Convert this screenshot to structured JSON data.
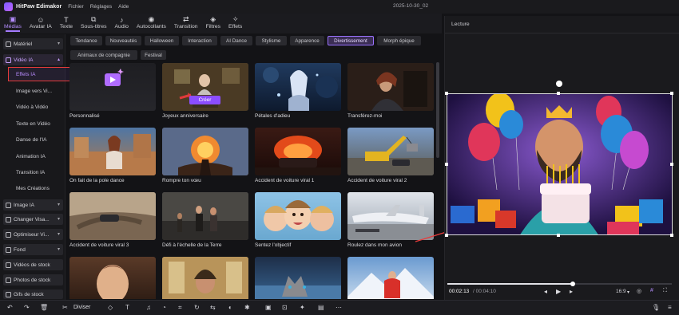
{
  "app": {
    "name": "HitPaw Edimakor",
    "menus": [
      "Fichier",
      "Réglages",
      "Aide"
    ],
    "doc_title": "2025-10-30_02"
  },
  "toolbar": [
    {
      "label": "Médias",
      "icon": "media-icon",
      "glyph": "▣",
      "active": true
    },
    {
      "label": "Avatar IA",
      "icon": "avatar-icon",
      "glyph": "☺",
      "active": false
    },
    {
      "label": "Texte",
      "icon": "text-icon",
      "glyph": "T",
      "active": false
    },
    {
      "label": "Sous-titres",
      "icon": "subtitles-icon",
      "glyph": "⧉",
      "active": false
    },
    {
      "label": "Audio",
      "icon": "audio-icon",
      "glyph": "♪",
      "active": false
    },
    {
      "label": "Autocollants",
      "icon": "sticker-icon",
      "glyph": "◉",
      "active": false
    },
    {
      "label": "Transition",
      "icon": "transition-icon",
      "glyph": "⇄",
      "active": false
    },
    {
      "label": "Filtres",
      "icon": "filter-icon",
      "glyph": "◈",
      "active": false
    },
    {
      "label": "Effets",
      "icon": "effects-icon",
      "glyph": "✧",
      "active": false
    }
  ],
  "sidebar": {
    "categories": [
      {
        "label": "Matériel",
        "open": false
      },
      {
        "label": "Vidéo IA",
        "open": true
      },
      {
        "label": "Image IA",
        "open": false
      },
      {
        "label": "Changer Visa...",
        "open": false
      },
      {
        "label": "Optimiseur Vi...",
        "open": false
      },
      {
        "label": "Fond",
        "open": false
      },
      {
        "label": "Vidéos de stock",
        "open": false
      },
      {
        "label": "Photos de stock",
        "open": false
      },
      {
        "label": "Gifs de stock",
        "open": false
      }
    ],
    "sub_items": [
      "Effets IA",
      "Image vers Vi...",
      "Vidéo à Vidéo",
      "Texte en Vidéo",
      "Danse de l'IA",
      "Animation IA",
      "Transition IA",
      "Mes Créations"
    ]
  },
  "chips": [
    "Tendance",
    "Nouveautés",
    "Halloween",
    "Interaction",
    "AI Dance",
    "Stylisme",
    "Apparence",
    "Divertissement",
    "Morph épique",
    "Animaux de compagnie",
    "Festival"
  ],
  "active_chip": "Divertissement",
  "cards": [
    {
      "caption": "Personnalisé"
    },
    {
      "caption": "Joyeux anniversaire",
      "button": "Créer"
    },
    {
      "caption": "Pétales d'adieu"
    },
    {
      "caption": "Transférez-moi"
    },
    {
      "caption": "On fait de la pole dance"
    },
    {
      "caption": "Rompre ton vœu"
    },
    {
      "caption": "Accident de voiture viral 1"
    },
    {
      "caption": "Accident de voiture viral 2"
    },
    {
      "caption": "Accident de voiture viral 3"
    },
    {
      "caption": "Défi à l'échelle de la Terre"
    },
    {
      "caption": "Sentez l'objectif"
    },
    {
      "caption": "Roulez dans mon avion"
    },
    {
      "caption": ""
    },
    {
      "caption": ""
    },
    {
      "caption": ""
    },
    {
      "caption": ""
    }
  ],
  "player": {
    "title": "Lecture",
    "current_time": "00:02:13",
    "total_time": "/ 00:04:10",
    "aspect": "16:9",
    "progress": 0.56
  },
  "bottom": {
    "split_label": "Diviser"
  }
}
